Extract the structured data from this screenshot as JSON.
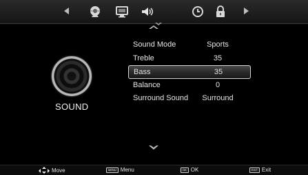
{
  "tabs": [
    {
      "name": "picture-tab",
      "icon": "picture-icon"
    },
    {
      "name": "channel-tab",
      "icon": "tv-icon"
    },
    {
      "name": "sound-tab",
      "icon": "speaker-icon"
    },
    {
      "name": "time-tab",
      "icon": "clock-icon"
    },
    {
      "name": "lock-tab",
      "icon": "lock-icon"
    }
  ],
  "panel": {
    "title": "SOUND",
    "icon": "speaker-graphic-icon"
  },
  "items": [
    {
      "label": "Sound Mode",
      "value": "Sports"
    },
    {
      "label": "Treble",
      "value": "35"
    },
    {
      "label": "Bass",
      "value": "35"
    },
    {
      "label": "Balance",
      "value": "0"
    },
    {
      "label": "Surround Sound",
      "value": "Surround"
    }
  ],
  "selected_index": 2,
  "footer": {
    "move_label": "Move",
    "menu_key": "MENU",
    "menu_label": "Menu",
    "ok_key": "OK",
    "ok_label": "OK",
    "exit_key": "EXIT",
    "exit_label": "Exit"
  }
}
